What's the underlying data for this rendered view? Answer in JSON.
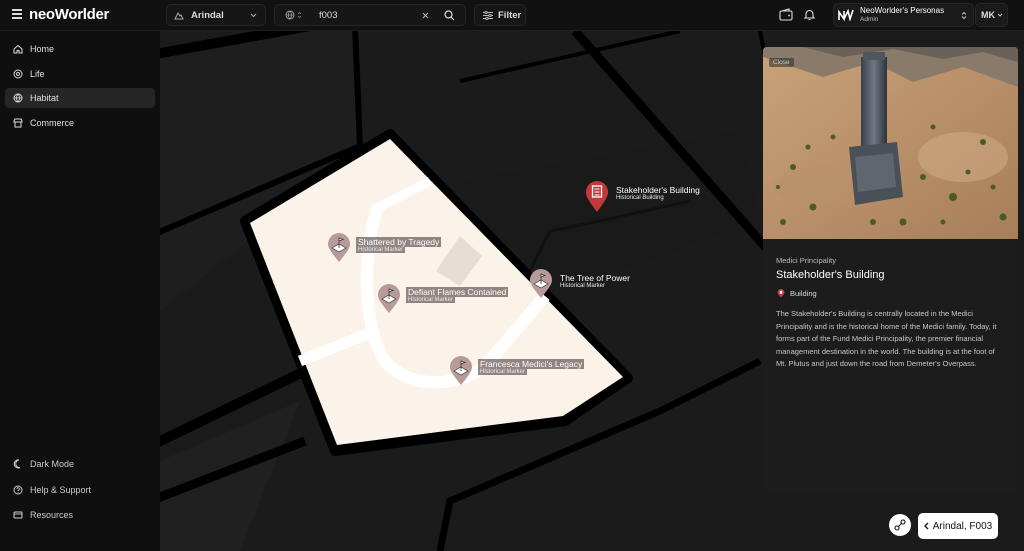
{
  "app": {
    "logo": "neoWorlder"
  },
  "header": {
    "location": "Arindal",
    "search_value": "f003",
    "filter_label": "Filter",
    "persona_name": "NeoWorlder's Personas",
    "persona_role": "Admin",
    "user_initials": "MK"
  },
  "sidebar": {
    "items": [
      {
        "label": "Home",
        "icon": "home-icon"
      },
      {
        "label": "Life",
        "icon": "life-icon"
      },
      {
        "label": "Habitat",
        "icon": "globe-icon",
        "active": true
      },
      {
        "label": "Commerce",
        "icon": "store-icon"
      }
    ],
    "footer": [
      {
        "label": "Dark Mode",
        "icon": "moon-icon"
      },
      {
        "label": "Help & Support",
        "icon": "help-icon"
      },
      {
        "label": "Resources",
        "icon": "resources-icon"
      }
    ]
  },
  "map": {
    "markers": [
      {
        "title": "Stakeholder's Building",
        "subtitle": "Historical Building",
        "icon": "building-icon",
        "color": "#c0393b"
      },
      {
        "title": "Shattered by Tragedy",
        "subtitle": "Historical Marker",
        "icon": "flag-icon",
        "color": "#b89a9a"
      },
      {
        "title": "The Tree of Power",
        "subtitle": "Historical Marker",
        "icon": "flag-icon",
        "color": "#b89a9a"
      },
      {
        "title": "Defiant Flames Contained",
        "subtitle": "Historical Marker",
        "icon": "flag-icon",
        "color": "#b89a9a"
      },
      {
        "title": "Francesca Medici's Legacy",
        "subtitle": "Historical Marker",
        "icon": "flag-icon",
        "color": "#b89a9a"
      }
    ]
  },
  "panel": {
    "close_label": "Close",
    "region": "Medici Principality",
    "title": "Stakeholder's Building",
    "type": "Building",
    "description": "The Stakeholder's Building is centrally located in the Medici Principality and is the historical home of the Medici family. Today, it forms part of the Fund Medici Principality, the premier financial management destination in the world. The building is at the foot of Mt. Plutus and just down the road from Demeter's Overpass."
  },
  "footer": {
    "location_label": "Arindal, F003"
  },
  "colors": {
    "parcel": "#fbf3ea",
    "road": "#000000",
    "accent": "#c0393b"
  }
}
